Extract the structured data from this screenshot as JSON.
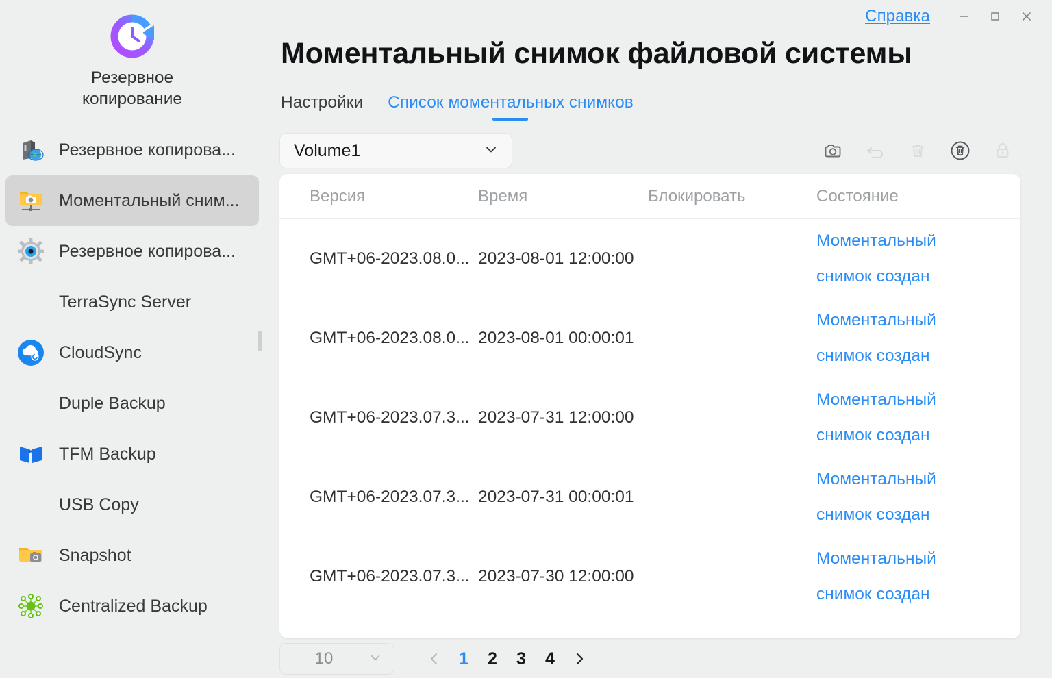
{
  "titlebar": {
    "help_label": "Справка",
    "minimize_icon": "minimize-icon",
    "maximize_icon": "maximize-icon",
    "close_icon": "close-icon"
  },
  "sidebar": {
    "app_icon": "clock-restore-icon",
    "app_name_line1": "Резервное",
    "app_name_line2": "копирование",
    "items": [
      {
        "label": "Резервное копирова...",
        "icon": "server-globe-icon",
        "selected": false,
        "has_icon": true
      },
      {
        "label": "Моментальный сним...",
        "icon": "snapshot-folder-network-icon",
        "selected": true,
        "has_icon": true
      },
      {
        "label": "Резервное копирова...",
        "icon": "gear-eye-icon",
        "selected": false,
        "has_icon": true
      },
      {
        "label": "TerraSync Server",
        "icon": "none",
        "selected": false,
        "has_icon": false
      },
      {
        "label": "CloudSync",
        "icon": "cloud-sync-icon",
        "selected": false,
        "has_icon": true
      },
      {
        "label": "Duple Backup",
        "icon": "none",
        "selected": false,
        "has_icon": false
      },
      {
        "label": "TFM Backup",
        "icon": "tfm-book-icon",
        "selected": false,
        "has_icon": true
      },
      {
        "label": "USB Copy",
        "icon": "none",
        "selected": false,
        "has_icon": false
      },
      {
        "label": "Snapshot",
        "icon": "snapshot-folder-icon",
        "selected": false,
        "has_icon": true
      },
      {
        "label": "Centralized Backup",
        "icon": "network-nodes-icon",
        "selected": false,
        "has_icon": true
      }
    ]
  },
  "main": {
    "page_title": "Моментальный снимок файловой системы",
    "tabs": [
      {
        "label": "Настройки",
        "active": false
      },
      {
        "label": "Список моментальных снимков",
        "active": true
      }
    ],
    "volume_select": {
      "value": "Volume1",
      "chevron_icon": "chevron-down-icon"
    },
    "toolbar": [
      {
        "name": "take-snapshot-button",
        "icon": "camera-icon",
        "enabled": true
      },
      {
        "name": "restore-button",
        "icon": "undo-arrow-icon",
        "enabled": false
      },
      {
        "name": "delete-button",
        "icon": "trash-icon",
        "enabled": false
      },
      {
        "name": "delete-all-button",
        "icon": "trash-circle-icon",
        "enabled": true
      },
      {
        "name": "lock-button",
        "icon": "lock-icon",
        "enabled": false
      }
    ],
    "table": {
      "headers": [
        "Версия",
        "Время",
        "Блокировать",
        "Состояние"
      ],
      "rows": [
        {
          "version": "GMT+06-2023.08.0...",
          "time": "2023-08-01 12:00:00",
          "lock": "",
          "status": "Моментальный снимок создан"
        },
        {
          "version": "GMT+06-2023.08.0...",
          "time": "2023-08-01 00:00:01",
          "lock": "",
          "status": "Моментальный снимок создан"
        },
        {
          "version": "GMT+06-2023.07.3...",
          "time": "2023-07-31 12:00:00",
          "lock": "",
          "status": "Моментальный снимок создан"
        },
        {
          "version": "GMT+06-2023.07.3...",
          "time": "2023-07-31 00:00:01",
          "lock": "",
          "status": "Моментальный снимок создан"
        },
        {
          "version": "GMT+06-2023.07.3...",
          "time": "2023-07-30 12:00:00",
          "lock": "",
          "status": "Моментальный снимок создан"
        }
      ]
    },
    "pagination": {
      "page_size": "10",
      "page_size_chevron": "chevron-down-icon",
      "prev_icon": "chevron-left-icon",
      "next_icon": "chevron-right-icon",
      "pages": [
        "1",
        "2",
        "3",
        "4"
      ],
      "current_page": "1"
    }
  },
  "colors": {
    "accent": "#2a8cf5",
    "bg": "#eef0ef",
    "panel": "#ffffff",
    "selected_nav": "#d5d5d5"
  }
}
